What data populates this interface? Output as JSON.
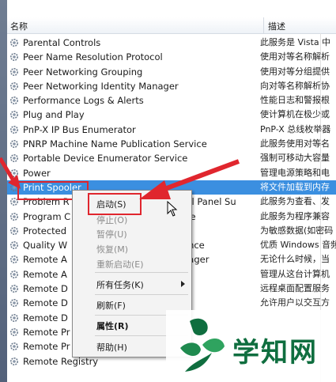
{
  "columns": {
    "name": "名称",
    "description": "描述"
  },
  "services": [
    {
      "name": "Parental Controls",
      "description": "此服务是 Vista 中"
    },
    {
      "name": "Peer Name Resolution Protocol",
      "description": "使用对等名称解析"
    },
    {
      "name": "Peer Networking Grouping",
      "description": "使用对等分组提供"
    },
    {
      "name": "Peer Networking Identity Manager",
      "description": "向对等名称解析协"
    },
    {
      "name": "Performance Logs & Alerts",
      "description": "性能日志和警报根"
    },
    {
      "name": "Plug and Play",
      "description": "使计算机在极少或"
    },
    {
      "name": "PnP-X IP Bus Enumerator",
      "description": "PnP-X 总线枚举器"
    },
    {
      "name": "PNRP Machine Name Publication Service",
      "description": "此服务使用对等名"
    },
    {
      "name": "Portable Device Enumerator Service",
      "description": "强制可移动大容量"
    },
    {
      "name": "Power",
      "description": "管理电源策略和电"
    },
    {
      "name": "Print Spooler",
      "description": "将文件加载到内存"
    },
    {
      "name": "Problem R",
      "name_tail": "rol Panel Su",
      "description": "此服务为查看、发"
    },
    {
      "name": "Program C",
      "name_tail": "ice",
      "description": "此服务为程序兼容"
    },
    {
      "name": "Protected",
      "description": "为敏感数据(如密码"
    },
    {
      "name": "Quality W",
      "name_tail": "ence",
      "description": "优质 Windows 音频"
    },
    {
      "name": "Remote A",
      "name_tail": "nager",
      "description": "无论什么时候，当"
    },
    {
      "name": "Remote A",
      "description": "管理从这台计算机"
    },
    {
      "name": "Remote D",
      "description": "远程桌面配置服务"
    },
    {
      "name": "Remote D",
      "description": "允许用户以交互方"
    },
    {
      "name": "Remote D",
      "description": ""
    },
    {
      "name": "Remote Pr",
      "description": ""
    },
    {
      "name": "Remote Pr",
      "description": ""
    },
    {
      "name": "Remote Registry",
      "description": ""
    }
  ],
  "context_menu": {
    "start": "启动(S)",
    "stop": "停止(O)",
    "pause": "暂停(U)",
    "resume": "恢复(M)",
    "restart": "重新启动(E)",
    "all_tasks": "所有任务(K)",
    "refresh": "刷新(F)",
    "properties": "属性(R)",
    "help": "帮助(H)"
  },
  "watermark": {
    "text": "学知网"
  },
  "colors": {
    "selection": "#3b8fe0",
    "highlight_box": "#e0262e",
    "watermark": "#0f6e3f"
  }
}
